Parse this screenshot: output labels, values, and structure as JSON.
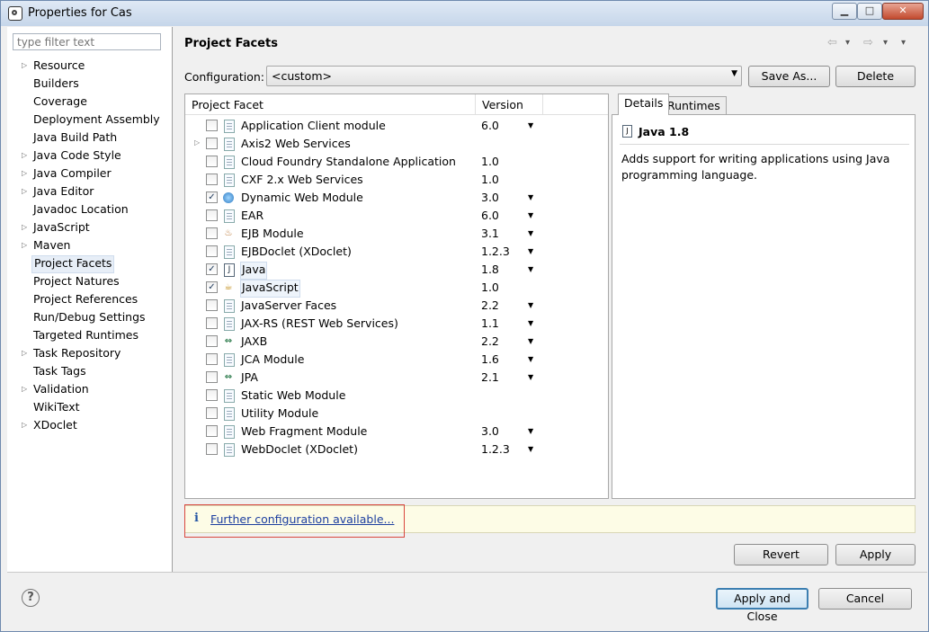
{
  "window": {
    "title": "Properties for Cas",
    "minimize": "▁",
    "maximize": "□",
    "close": "✕"
  },
  "filter": {
    "placeholder": "type filter text"
  },
  "sidebar": {
    "items": [
      {
        "label": "Resource",
        "expandable": true
      },
      {
        "label": "Builders",
        "expandable": false
      },
      {
        "label": "Coverage",
        "expandable": false
      },
      {
        "label": "Deployment Assembly",
        "expandable": false
      },
      {
        "label": "Java Build Path",
        "expandable": false
      },
      {
        "label": "Java Code Style",
        "expandable": true
      },
      {
        "label": "Java Compiler",
        "expandable": true
      },
      {
        "label": "Java Editor",
        "expandable": true
      },
      {
        "label": "Javadoc Location",
        "expandable": false
      },
      {
        "label": "JavaScript",
        "expandable": true
      },
      {
        "label": "Maven",
        "expandable": true
      },
      {
        "label": "Project Facets",
        "expandable": false,
        "selected": true
      },
      {
        "label": "Project Natures",
        "expandable": false
      },
      {
        "label": "Project References",
        "expandable": false
      },
      {
        "label": "Run/Debug Settings",
        "expandable": false
      },
      {
        "label": "Targeted Runtimes",
        "expandable": false
      },
      {
        "label": "Task Repository",
        "expandable": true
      },
      {
        "label": "Task Tags",
        "expandable": false
      },
      {
        "label": "Validation",
        "expandable": true
      },
      {
        "label": "WikiText",
        "expandable": false
      },
      {
        "label": "XDoclet",
        "expandable": true
      }
    ]
  },
  "page": {
    "title": "Project Facets",
    "nav_back": "⇦",
    "nav_forward": "⇨",
    "nav_back_menu": "▾",
    "nav_forward_menu": "▾",
    "view_menu": "▾"
  },
  "configuration": {
    "label": "Configuration:",
    "value": "<custom>",
    "save_as": "Save As...",
    "delete": "Delete"
  },
  "facets": {
    "col_facet": "Project Facet",
    "col_version": "Version",
    "rows": [
      {
        "name": "Application Client module",
        "version": "6.0",
        "checked": false,
        "icon": "doc",
        "dropdown": true
      },
      {
        "name": "Axis2 Web Services",
        "version": "",
        "checked": false,
        "icon": "doc",
        "dropdown": false,
        "expandable": true
      },
      {
        "name": "Cloud Foundry Standalone Application",
        "version": "1.0",
        "checked": false,
        "icon": "doc",
        "dropdown": false
      },
      {
        "name": "CXF 2.x Web Services",
        "version": "1.0",
        "checked": false,
        "icon": "doc",
        "dropdown": false
      },
      {
        "name": "Dynamic Web Module",
        "version": "3.0",
        "checked": true,
        "icon": "globe",
        "dropdown": true
      },
      {
        "name": "EAR",
        "version": "6.0",
        "checked": false,
        "icon": "doc",
        "dropdown": true
      },
      {
        "name": "EJB Module",
        "version": "3.1",
        "checked": false,
        "icon": "bean",
        "dropdown": true
      },
      {
        "name": "EJBDoclet (XDoclet)",
        "version": "1.2.3",
        "checked": false,
        "icon": "doc",
        "dropdown": true
      },
      {
        "name": "Java",
        "version": "1.8",
        "checked": true,
        "icon": "javaf",
        "dropdown": true,
        "boxed": true
      },
      {
        "name": "JavaScript",
        "version": "1.0",
        "checked": true,
        "icon": "jsf",
        "dropdown": false,
        "boxed": true
      },
      {
        "name": "JavaServer Faces",
        "version": "2.2",
        "checked": false,
        "icon": "doc",
        "dropdown": true
      },
      {
        "name": "JAX-RS (REST Web Services)",
        "version": "1.1",
        "checked": false,
        "icon": "doc",
        "dropdown": true
      },
      {
        "name": "JAXB",
        "version": "2.2",
        "checked": false,
        "icon": "sym",
        "dropdown": true
      },
      {
        "name": "JCA Module",
        "version": "1.6",
        "checked": false,
        "icon": "doc",
        "dropdown": true
      },
      {
        "name": "JPA",
        "version": "2.1",
        "checked": false,
        "icon": "sym",
        "dropdown": true
      },
      {
        "name": "Static Web Module",
        "version": "",
        "checked": false,
        "icon": "doc",
        "dropdown": false
      },
      {
        "name": "Utility Module",
        "version": "",
        "checked": false,
        "icon": "doc",
        "dropdown": false
      },
      {
        "name": "Web Fragment Module",
        "version": "3.0",
        "checked": false,
        "icon": "doc",
        "dropdown": true
      },
      {
        "name": "WebDoclet (XDoclet)",
        "version": "1.2.3",
        "checked": false,
        "icon": "doc",
        "dropdown": true
      }
    ]
  },
  "details": {
    "tab_details": "Details",
    "tab_runtimes": "Runtimes",
    "title": "Java 1.8",
    "icon_glyph": "J",
    "description": "Adds support for writing applications using Java programming language."
  },
  "notice": {
    "icon": "i",
    "link": "Further configuration available..."
  },
  "buttons": {
    "revert": "Revert",
    "apply": "Apply",
    "apply_close": "Apply and Close",
    "cancel": "Cancel",
    "help": "?"
  },
  "colors": {
    "accent": "#3c7fb1",
    "link": "#1d3fa0",
    "highlight_box": "#d9463d"
  }
}
